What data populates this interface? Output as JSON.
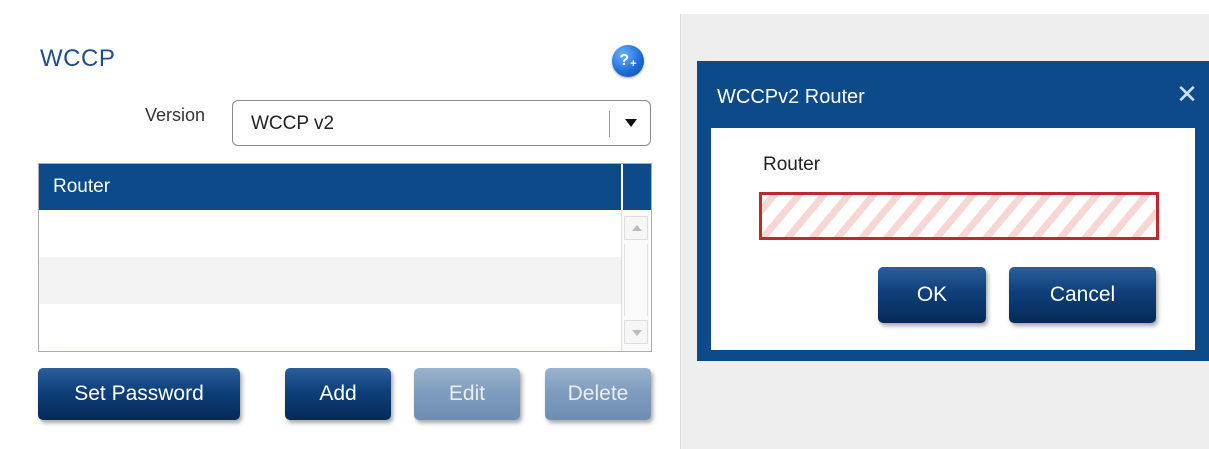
{
  "wccp": {
    "title": "WCCP",
    "help_icon": "help-add-icon",
    "help_icon_text": "?",
    "help_icon_plus": "+",
    "version_label": "Version",
    "version_value": "WCCP v2",
    "table": {
      "columns": [
        "Router"
      ],
      "rows": []
    },
    "buttons": {
      "set_password": "Set Password",
      "add": "Add",
      "edit": "Edit",
      "delete": "Delete"
    }
  },
  "dialog": {
    "title": "WCCPv2 Router",
    "close_icon": "close-icon",
    "close_glyph": "✕",
    "field_label": "Router",
    "field_value": "",
    "ok_label": "OK",
    "cancel_label": "Cancel"
  },
  "colors": {
    "brand_blue": "#0d4a8a",
    "title_blue": "#1e4e8c",
    "error_red": "#c0282f",
    "disabled_button": "#7d9bbd"
  }
}
